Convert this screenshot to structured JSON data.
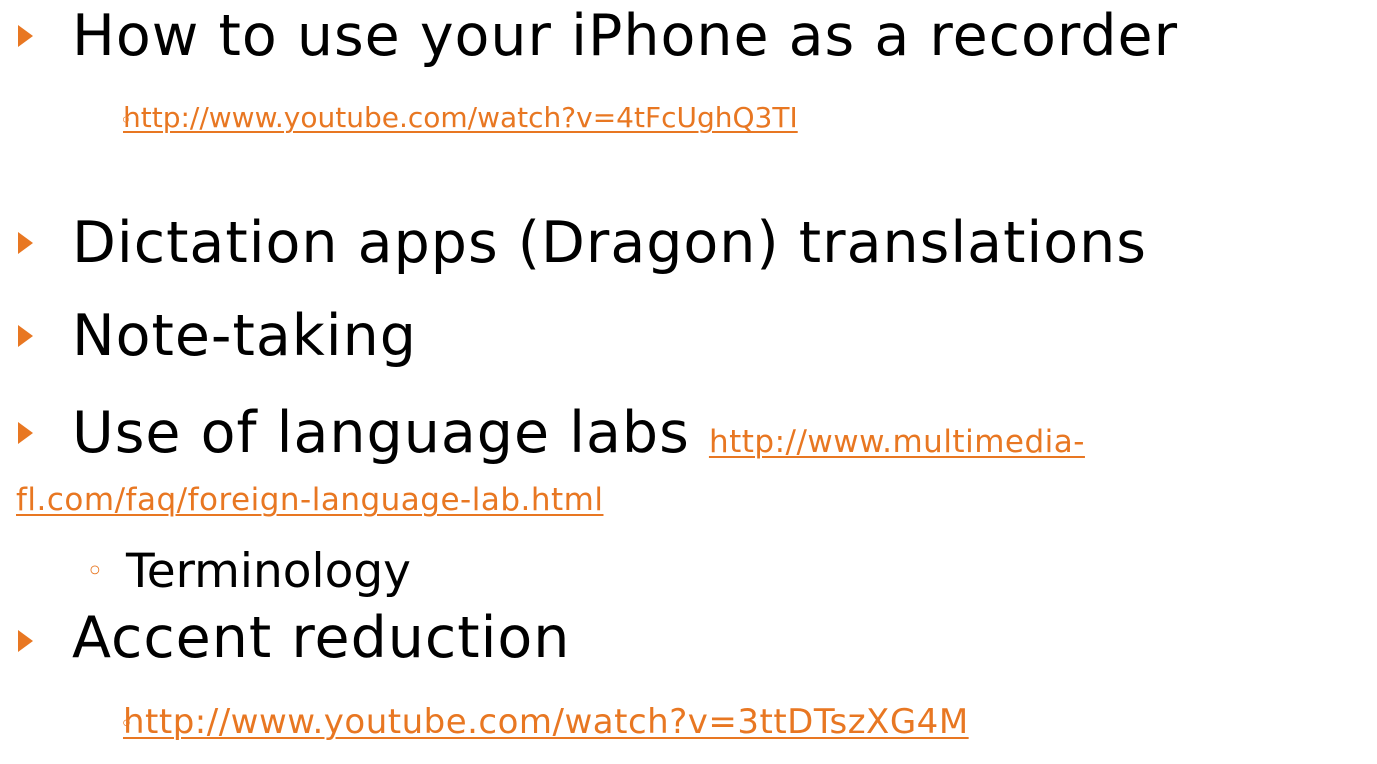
{
  "colors": {
    "accent": "#e87722",
    "text": "#000000",
    "background": "#ffffff"
  },
  "items": [
    {
      "text": "How to use your iPhone as a recorder",
      "sub_link": "http://www.youtube.com/watch?v=4tFcUghQ3TI"
    },
    {
      "text": "Dictation apps (Dragon) translations"
    },
    {
      "text": "Note-taking"
    },
    {
      "text": "Use of language labs",
      "link_part1": "http://www.multimedia-",
      "link_part2": "fl.com/faq/foreign-language-lab.html",
      "sub_text": "Terminology"
    },
    {
      "text": "Accent reduction",
      "sub_link": "http://www.youtube.com/watch?v=3ttDTszXG4M"
    }
  ],
  "icons": {
    "level1_bullet": "orange-triangle-icon",
    "level2_bullet": "small-circle-icon"
  }
}
